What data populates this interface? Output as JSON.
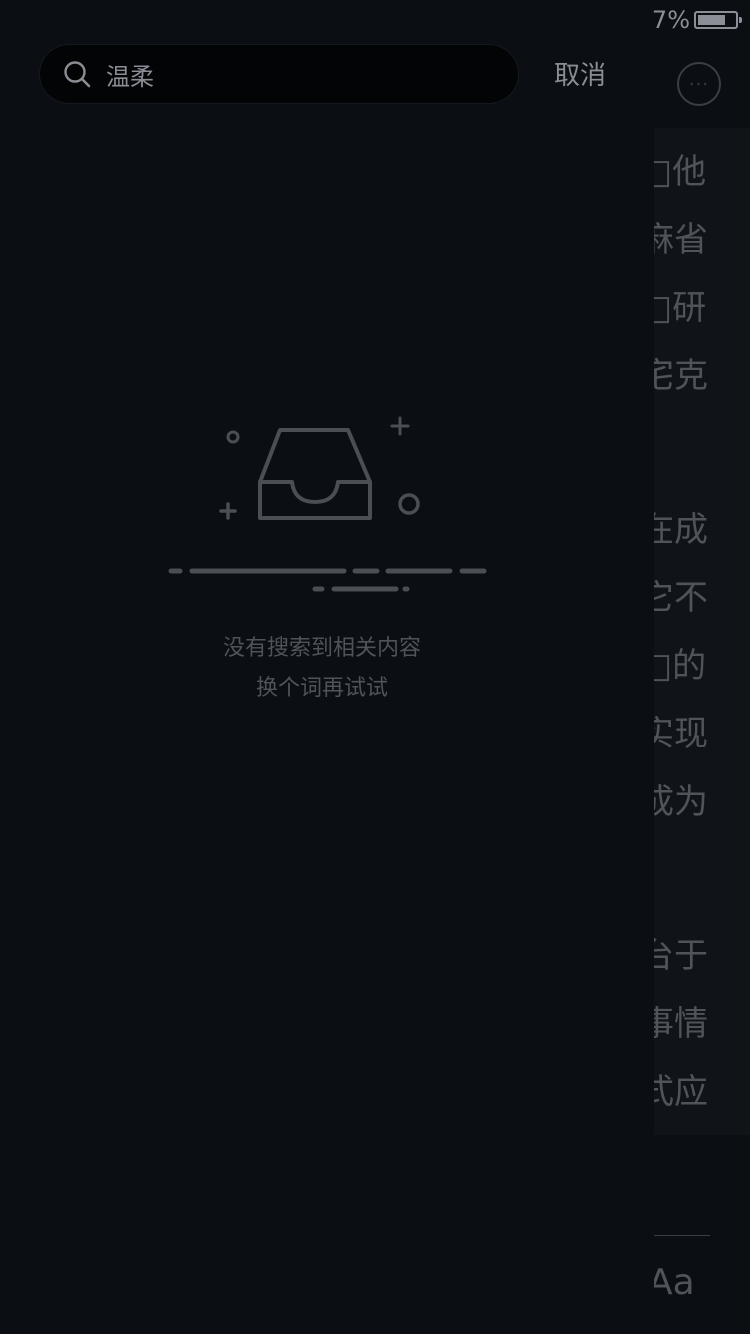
{
  "status_bar": {
    "battery_text": "7%",
    "battery_level": 0.75
  },
  "search": {
    "query": "温柔",
    "cancel_label": "取消"
  },
  "empty_state": {
    "title": "没有搜索到相关内容",
    "subtitle": "换个词再试试"
  },
  "reader_background": {
    "lines": [
      "□他",
      "麻省",
      "□研",
      "宅克",
      "在成",
      "它不",
      "□的",
      "实现",
      "成为",
      "台于",
      "事情",
      "式应"
    ],
    "font_button": "Aa"
  },
  "colors": {
    "background": "#0b0e12",
    "search_field": "#030406",
    "text_muted": "#8a8e94",
    "illustration": "#4a4e55"
  }
}
